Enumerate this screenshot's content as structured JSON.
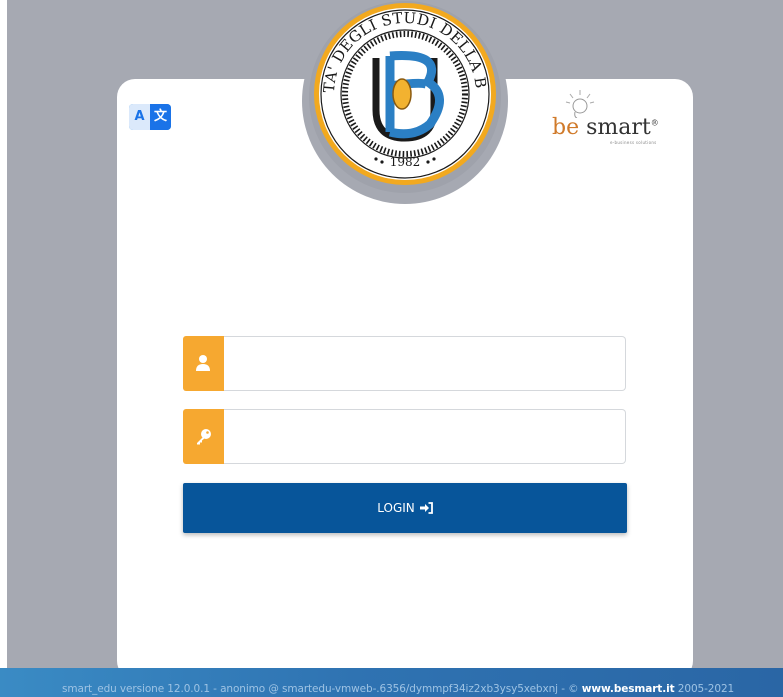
{
  "login_form": {
    "username": {
      "value": "",
      "placeholder": ""
    },
    "password": {
      "value": "",
      "placeholder": ""
    },
    "login_label": "LOGIN"
  },
  "translate_button": {
    "label_a": "A",
    "label_b": "文"
  },
  "university_seal": {
    "ring_text": "UNIVERSITA' DEGLI STUDI DELLA BASILICATA",
    "year": "1982"
  },
  "partner_logo": {
    "be": "be",
    "smart": "smart",
    "mark": "®",
    "tagline": "e-business solutions"
  },
  "footer": {
    "text": "smart_edu versione 12.0.0.1 - anonimo @ smartedu-vmweb-.6356/dymmpf34iz2xb3ysy5xebxnj - © ",
    "link_label": "www.besmart.it",
    "years": " 2005-2021"
  },
  "icons": {
    "user": "user-icon",
    "key": "key-icon",
    "login": "sign-in-icon",
    "translate": "translate-icon"
  },
  "colors": {
    "background": "#a6a9b2",
    "addon": "#f6a830",
    "login_button": "#07559a",
    "footer": "#2f73b2",
    "seal_gold": "#f2a91f",
    "seal_blue": "#2b7fc4"
  }
}
